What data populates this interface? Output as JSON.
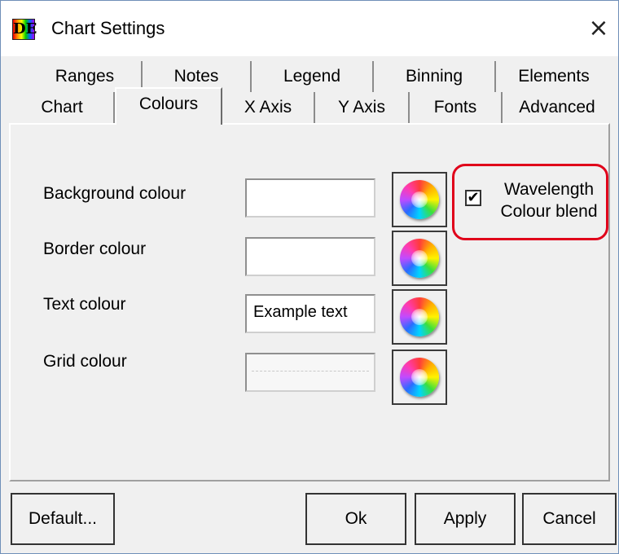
{
  "window": {
    "title": "Chart Settings",
    "app_icon_text": "DE",
    "close_glyph": "×"
  },
  "tabs": {
    "row1": [
      "Ranges",
      "Notes",
      "Legend",
      "Binning",
      "Elements"
    ],
    "row2": [
      "Chart",
      "Colours",
      "X Axis",
      "Y Axis",
      "Fonts",
      "Advanced"
    ],
    "selected": "Colours"
  },
  "colours": {
    "background_label": "Background colour",
    "border_label": "Border colour",
    "text_label": "Text colour",
    "text_example": "Example text",
    "grid_label": "Grid colour"
  },
  "wavelength": {
    "line1": "Wavelength",
    "line2": "Colour blend",
    "checked": true,
    "check_glyph": "✔"
  },
  "buttons": {
    "default": "Default...",
    "ok": "Ok",
    "apply": "Apply",
    "cancel": "Cancel"
  },
  "icons": {
    "picker": "colour-wheel-icon"
  },
  "accent": {
    "highlight": "#e0001a",
    "window_border": "#6f8fb8"
  }
}
